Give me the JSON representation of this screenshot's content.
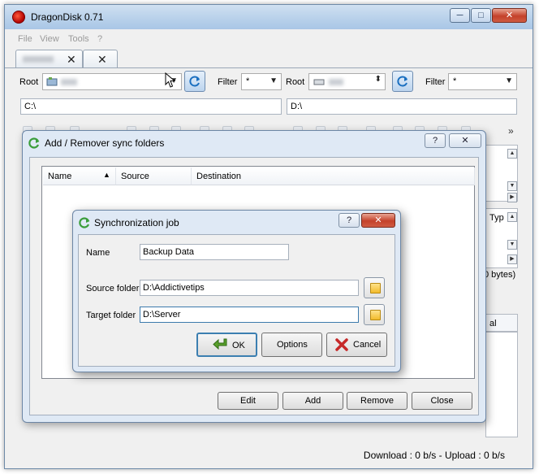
{
  "app": {
    "title": "DragonDisk 0.71"
  },
  "window_controls": {
    "minimize": "─",
    "maximize": "□",
    "close": "✕"
  },
  "menu": [
    "File",
    "View",
    "Tools",
    "?"
  ],
  "tabs": [
    {
      "close": "✕"
    },
    {
      "close": "✕"
    }
  ],
  "left_panel": {
    "root_label": "Root",
    "filter_label": "Filter",
    "filter_value": "*",
    "path": "C:\\"
  },
  "right_panel": {
    "root_label": "Root",
    "filter_label": "Filter",
    "filter_value": "*",
    "path": "D:\\",
    "col_type": "Typ",
    "size_text": "0 bytes)",
    "col_partial": "al",
    "more": "»"
  },
  "sync_dialog": {
    "title": "Add / Remover sync folders",
    "help": "?",
    "close": "✕",
    "columns": [
      "Name",
      "Source",
      "Destination"
    ],
    "sort_indicator": "▲",
    "buttons": {
      "edit": "Edit",
      "add": "Add",
      "remove": "Remove",
      "close": "Close"
    }
  },
  "job_dialog": {
    "title": "Synchronization job",
    "help": "?",
    "close": "✕",
    "name_label": "Name",
    "name_value": "Backup Data",
    "source_label": "Source folder",
    "source_value": "D:\\Addictivetips",
    "target_label": "Target folder",
    "target_value": "D:\\Server",
    "ok": "OK",
    "options": "Options",
    "cancel": "Cancel"
  },
  "status": {
    "text": "Download : 0 b/s - Upload : 0 b/s"
  }
}
